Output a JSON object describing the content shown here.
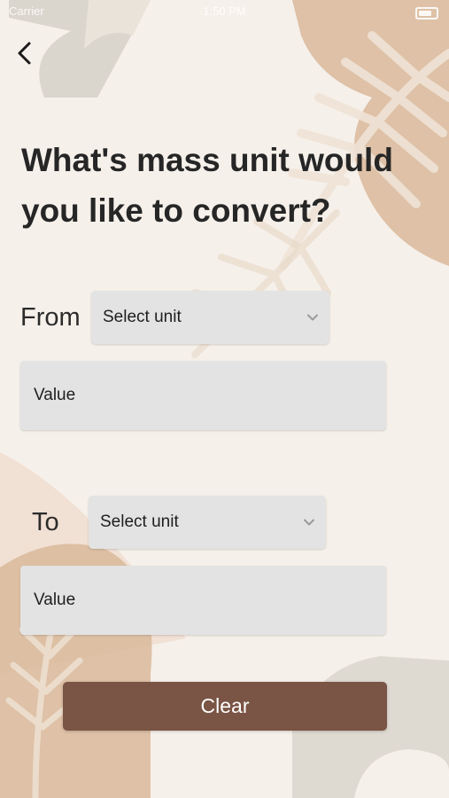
{
  "status_bar": {
    "carrier": "Carrier",
    "time": "1:50 PM"
  },
  "title": "What's mass unit would you like to convert?",
  "from": {
    "label": "From",
    "select_placeholder": "Select unit",
    "value_placeholder": "Value"
  },
  "to": {
    "label": "To",
    "select_placeholder": "Select unit",
    "value_placeholder": "Value"
  },
  "clear_button": "Clear",
  "colors": {
    "background": "#f6f0ea",
    "field": "#e3e3e3",
    "button": "#7a5444",
    "accent_leaf": "#ddc2a9"
  },
  "icons": {
    "back": "back-chevron-icon",
    "dropdown": "chevron-down-icon"
  }
}
